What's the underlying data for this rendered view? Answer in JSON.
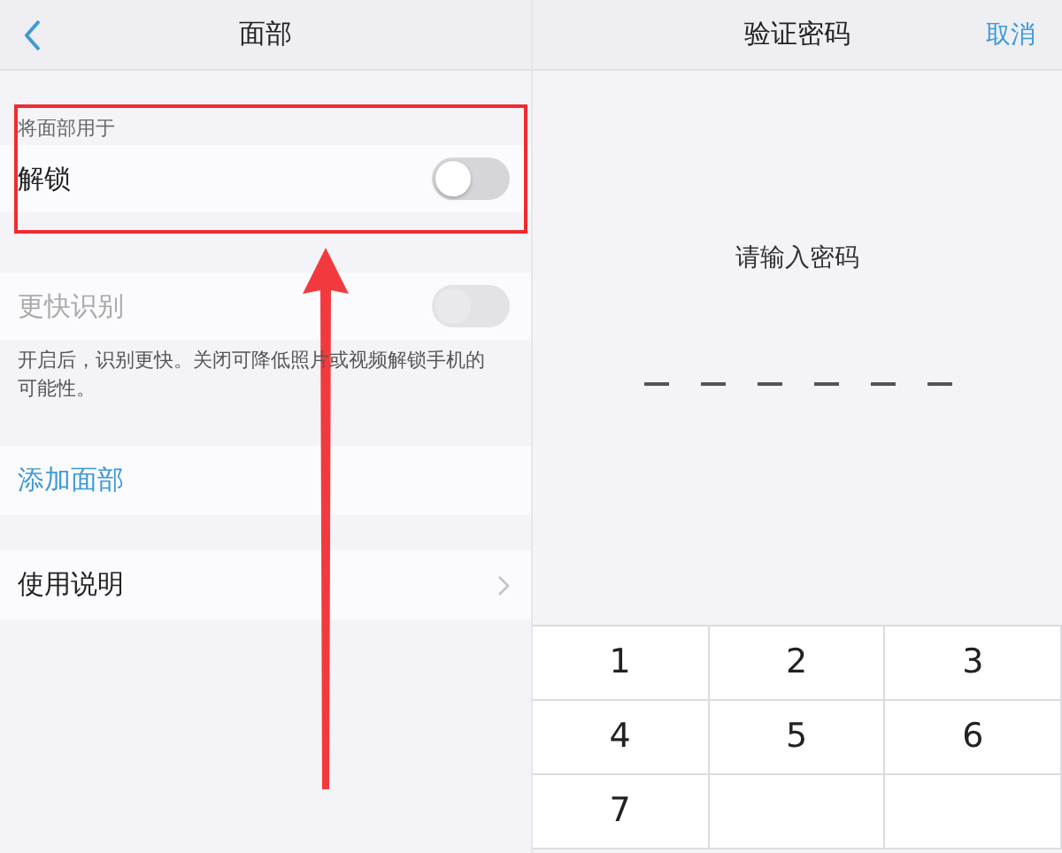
{
  "left_screen": {
    "nav_bar": {
      "title": "面部"
    },
    "section_label": "将面部用于",
    "settings": [
      {
        "kind": "toggle",
        "label": "解锁",
        "on": false,
        "disabled": false
      },
      {
        "kind": "toggle",
        "label": "更快识别",
        "on": false,
        "disabled": true
      }
    ],
    "footnote": "开启后，识别更快。关闭可降低照片或视频解锁手机的可能性。",
    "links": [
      {
        "kind": "action",
        "label": "添加面部"
      },
      {
        "kind": "nav",
        "label": "使用说明"
      }
    ]
  },
  "right_screen": {
    "nav_bar": {
      "title": "验证密码",
      "action": "取消"
    },
    "prompt": "请输入密码",
    "pin_slots": [
      {
        "filled": false
      },
      {
        "filled": false
      },
      {
        "filled": false
      },
      {
        "filled": false
      },
      {
        "filled": false
      },
      {
        "filled": false
      }
    ],
    "keypad": [
      "1",
      "2",
      "3",
      "4",
      "5",
      "6",
      "7"
    ]
  }
}
